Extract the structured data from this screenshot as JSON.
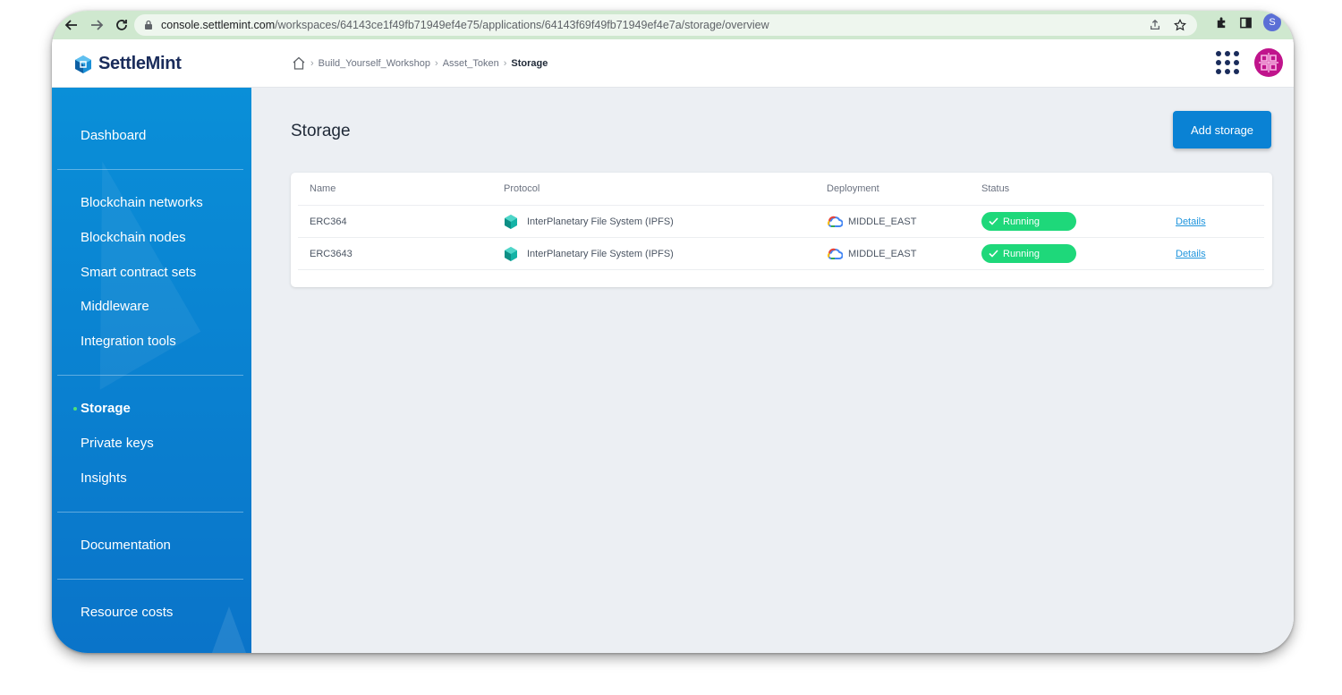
{
  "browser": {
    "url_host": "console.settlemint.com",
    "url_path": "/workspaces/64143ce1f49fb71949ef4e75/applications/64143f69f49fb71949ef4e7a/storage/overview",
    "profile_initial": "S"
  },
  "header": {
    "logo_text": "SettleMint",
    "breadcrumb": [
      "Build_Yourself_Workshop",
      "Asset_Token",
      "Storage"
    ]
  },
  "sidebar": {
    "items": [
      {
        "label": "Dashboard"
      },
      {
        "label": "Blockchain networks"
      },
      {
        "label": "Blockchain nodes"
      },
      {
        "label": "Smart contract sets"
      },
      {
        "label": "Middleware"
      },
      {
        "label": "Integration tools"
      },
      {
        "label": "Storage",
        "active": true
      },
      {
        "label": "Private keys"
      },
      {
        "label": "Insights"
      },
      {
        "label": "Documentation"
      },
      {
        "label": "Resource costs"
      }
    ]
  },
  "main": {
    "title": "Storage",
    "add_button": "Add storage",
    "table": {
      "columns": [
        "Name",
        "Protocol",
        "Deployment",
        "Status"
      ],
      "rows": [
        {
          "name": "ERC364",
          "protocol": "InterPlanetary File System (IPFS)",
          "deployment": "MIDDLE_EAST",
          "status": "Running",
          "action": "Details"
        },
        {
          "name": "ERC3643",
          "protocol": "InterPlanetary File System (IPFS)",
          "deployment": "MIDDLE_EAST",
          "status": "Running",
          "action": "Details"
        }
      ]
    }
  },
  "colors": {
    "sidebar": "#0a82d4",
    "status_running": "#1ed87a",
    "accent": "#0a82d4",
    "link": "#1f95dd"
  }
}
